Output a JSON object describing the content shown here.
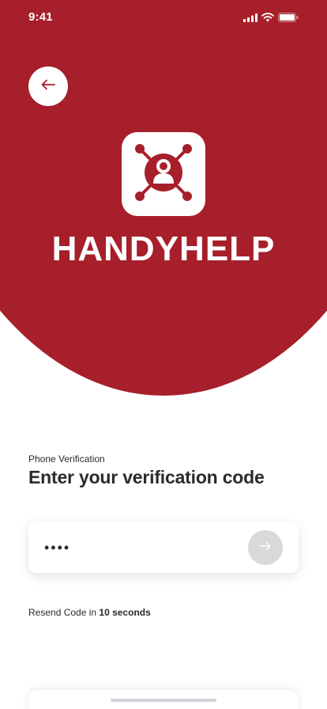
{
  "colors": {
    "brand_red": "#A61F2A",
    "white": "#FFFFFF",
    "text_dark": "#2B2B2B",
    "button_disabled": "#D9D9D9"
  },
  "status_bar": {
    "time": "9:41",
    "icons": [
      "signal-icon",
      "wifi-icon",
      "battery-icon"
    ]
  },
  "header": {
    "back_icon": "arrow-left-icon",
    "logo_icon": "network-person-icon",
    "brand_name": "HANDYHELP"
  },
  "verification": {
    "caption": "Phone Verification",
    "title": "Enter your verification code",
    "code_value": "••••",
    "submit_icon": "arrow-right-icon"
  },
  "resend": {
    "prefix": "Resend Code in",
    "countdown": "10 seconds"
  }
}
